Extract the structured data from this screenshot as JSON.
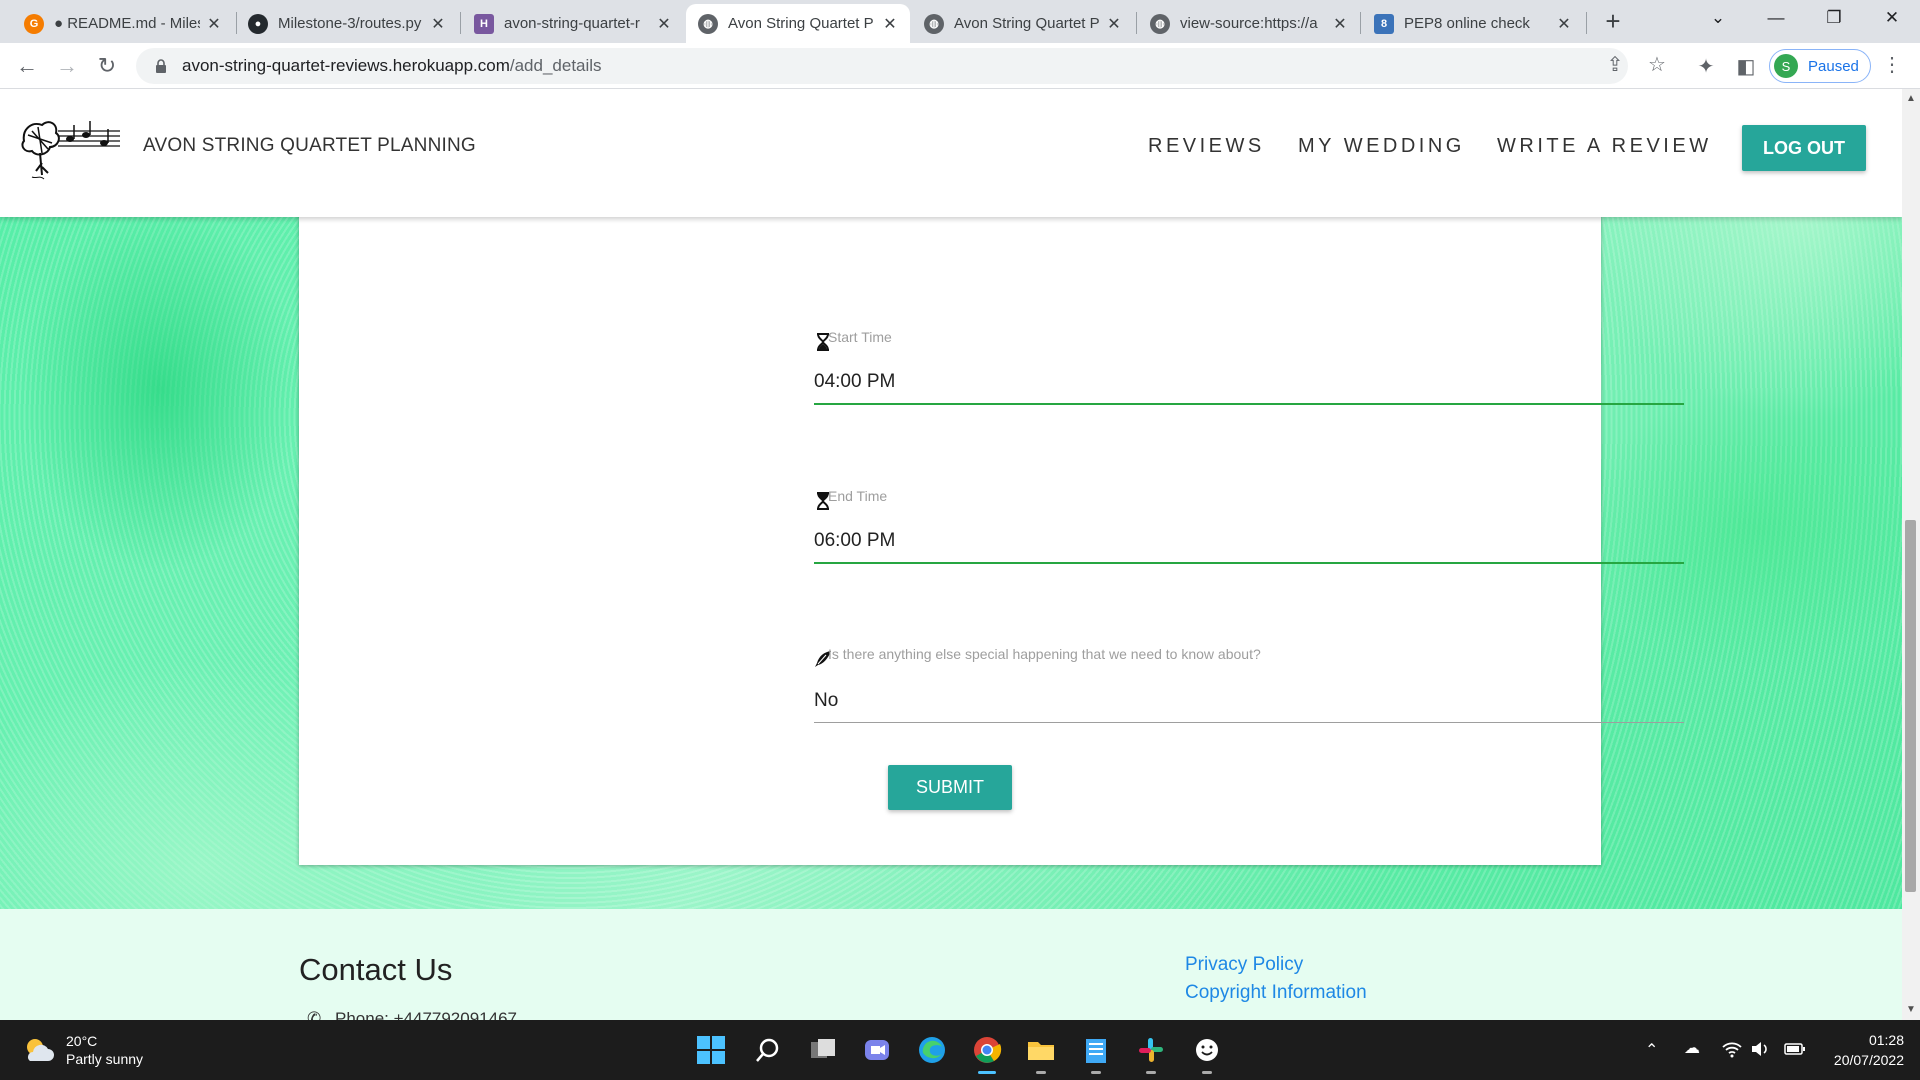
{
  "browser": {
    "tabs": [
      {
        "title": "● README.md - Miles",
        "favicon": "gitpod-icon",
        "color": "#f57c00",
        "active": false
      },
      {
        "title": "Milestone-3/routes.py",
        "favicon": "github-icon",
        "color": "#24292e",
        "active": false
      },
      {
        "title": "avon-string-quartet-r",
        "favicon": "heroku-icon",
        "color": "#79589f",
        "active": false
      },
      {
        "title": "Avon String Quartet P",
        "favicon": "globe-icon",
        "color": "#5f6368",
        "active": true
      },
      {
        "title": "Avon String Quartet P",
        "favicon": "globe-icon",
        "color": "#5f6368",
        "active": false
      },
      {
        "title": "view-source:https://a",
        "favicon": "globe-icon",
        "color": "#5f6368",
        "active": false
      },
      {
        "title": "PEP8 online check",
        "favicon": "pep8-icon",
        "color": "#3b73b9",
        "active": false
      }
    ],
    "url_host": "avon-string-quartet-reviews.herokuapp.com",
    "url_path": "/add_details",
    "profile_initial": "S",
    "profile_status": "Paused"
  },
  "site": {
    "brand": "AVON STRING QUARTET PLANNING",
    "nav": {
      "reviews": "REVIEWS",
      "my_wedding": "MY WEDDING",
      "write_review": "WRITE A REVIEW",
      "logout": "LOG OUT"
    },
    "accent": "#26a69a"
  },
  "form": {
    "start_time": {
      "label": "Start Time",
      "value": "04:00 PM"
    },
    "end_time": {
      "label": "End Time",
      "value": "06:00 PM"
    },
    "special": {
      "label": "Is there anything else special happening that we need to know about?",
      "value": "No"
    },
    "submit": "SUBMIT"
  },
  "footer": {
    "contact_title": "Contact Us",
    "phone": "Phone: +447792091467",
    "links": [
      "Privacy Policy",
      "Copyright Information"
    ]
  },
  "taskbar": {
    "temperature": "20°C",
    "condition": "Partly sunny",
    "time": "01:28",
    "date": "20/07/2022"
  }
}
